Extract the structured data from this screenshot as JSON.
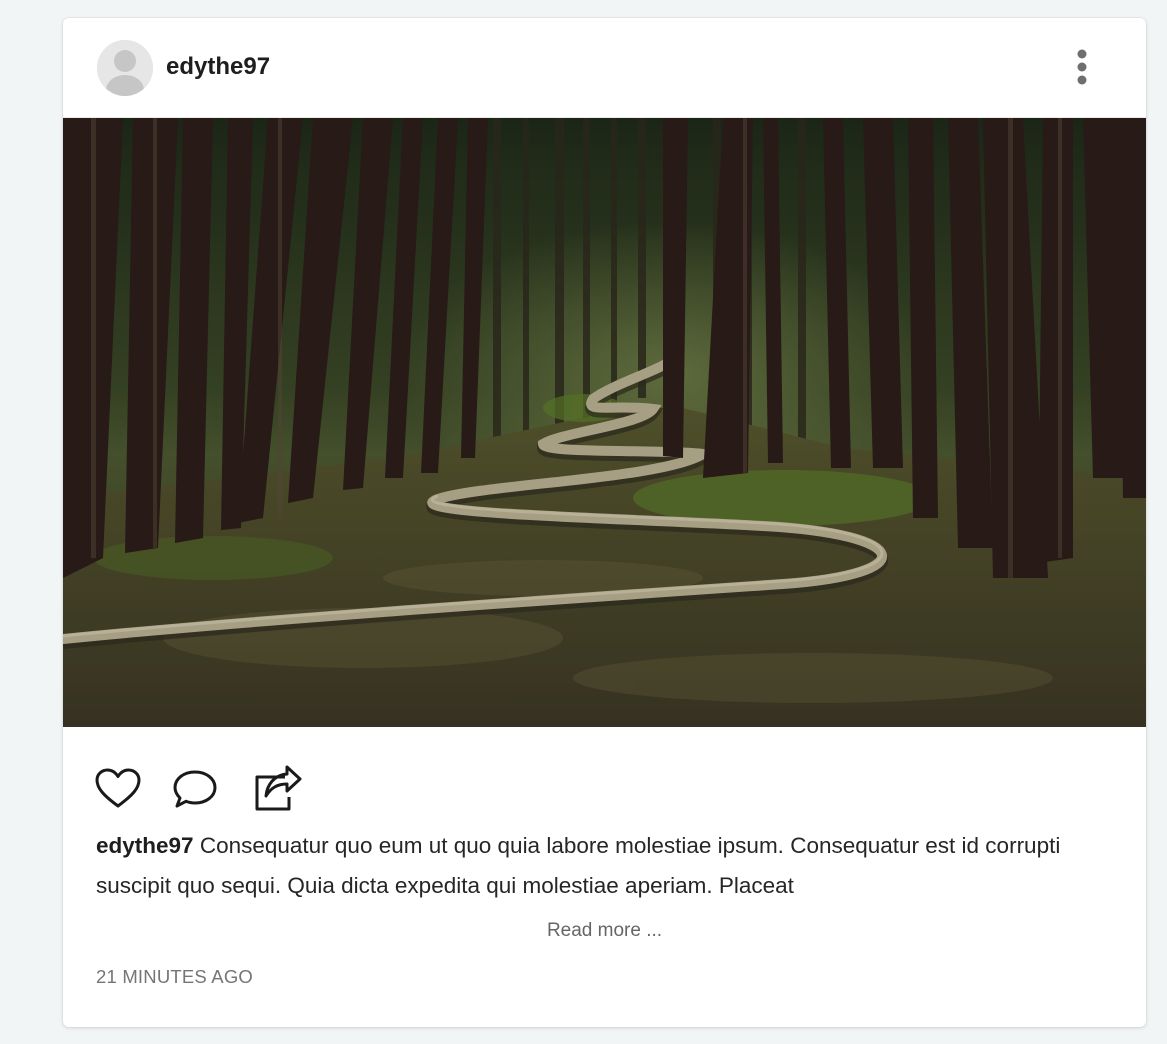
{
  "post": {
    "username": "edythe97",
    "avatar_icon": "default-user-avatar-icon",
    "menu_icon": "vertical-dots-icon",
    "image": {
      "subject": "winding log path through a dark eucalyptus forest",
      "colors": {
        "trees": "#2a1c18",
        "moss": "#5b6a2c",
        "log": "#b8ad92",
        "ground": "#4b4630"
      }
    },
    "actions": [
      {
        "name": "like",
        "icon": "heart-outline-icon"
      },
      {
        "name": "comment",
        "icon": "speech-bubble-icon"
      },
      {
        "name": "share",
        "icon": "share-arrow-icon"
      }
    ],
    "caption_user": "edythe97",
    "caption_text": "Consequatur quo eum ut quo quia labore molestiae ipsum. Consequatur est id corrupti suscipit quo sequi. Quia dicta expedita qui molestiae aperiam. Placeat",
    "read_more_label": "Read more ...",
    "timestamp": "21 MINUTES AGO"
  }
}
